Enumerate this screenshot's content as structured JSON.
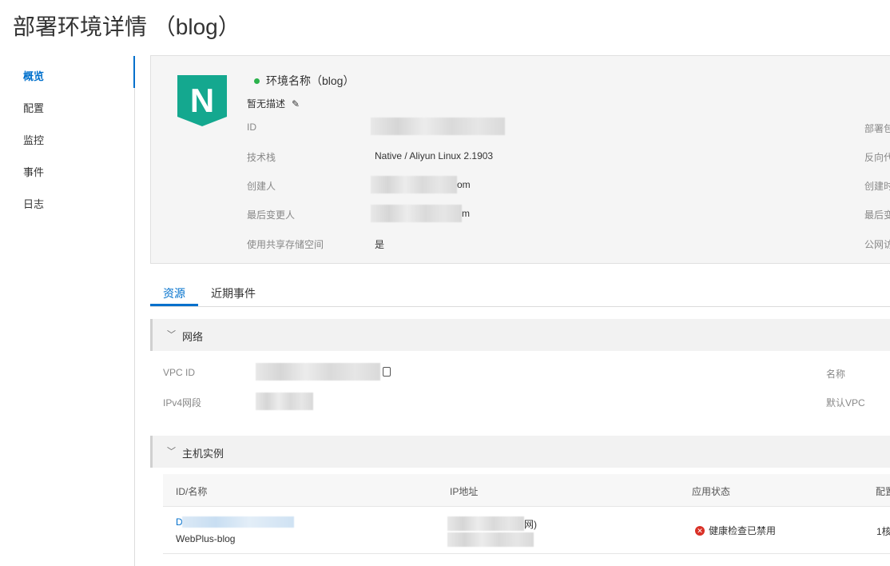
{
  "page": {
    "title": "部署环境详情 （blog）"
  },
  "sidebar": {
    "items": [
      {
        "label": "概览",
        "active": true
      },
      {
        "label": "配置"
      },
      {
        "label": "监控"
      },
      {
        "label": "事件"
      },
      {
        "label": "日志"
      }
    ]
  },
  "overview": {
    "logo_letter": "N",
    "env_name": "环境名称（blog）",
    "status_color": "#2bb24c",
    "description": "暂无描述",
    "fields": {
      "id_label": "ID",
      "stack_label": "技术栈",
      "stack_value": "Native / Aliyun Linux 2.1903",
      "creator_label": "创建人",
      "creator_value_tail": "om",
      "modifier_label": "最后变更人",
      "modifier_value_tail": "m",
      "shared_storage_label": "使用共享存储空间",
      "shared_storage_value": "是"
    },
    "right_labels": [
      "部署包",
      "反向代",
      "创建时",
      "最后变",
      "公网访"
    ]
  },
  "tabs": [
    {
      "label": "资源",
      "active": true
    },
    {
      "label": "近期事件"
    }
  ],
  "network": {
    "title": "网络",
    "vpc_id_label": "VPC ID",
    "ipv4_label": "IPv4网段",
    "name_label": "名称",
    "default_vpc_label": "默认VPC"
  },
  "instances": {
    "title": "主机实例",
    "columns": [
      "ID/名称",
      "IP地址",
      "应用状态",
      "配置"
    ],
    "rows": [
      {
        "id_prefix": "D",
        "name": "WebPlus-blog",
        "ip_tail": "网)",
        "status": "健康检查已禁用",
        "config": "1核"
      }
    ]
  },
  "colors": {
    "accent": "#0070cc",
    "logo": "#14a88f",
    "error": "#d93026"
  }
}
